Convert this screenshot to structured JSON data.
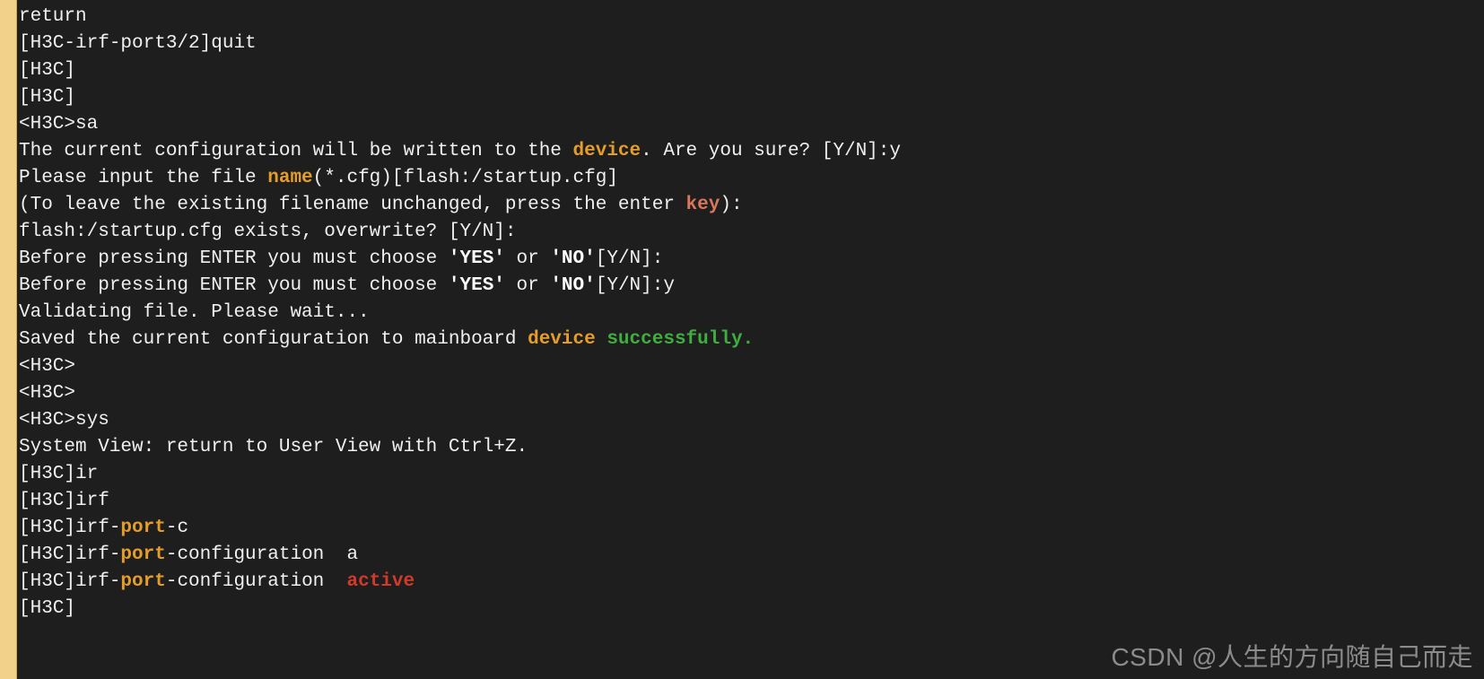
{
  "segments": [
    {
      "t": "return",
      "c": ""
    },
    {
      "t": "\n",
      "c": ""
    },
    {
      "t": "[H3C-irf-port3/2]quit",
      "c": ""
    },
    {
      "t": "\n",
      "c": ""
    },
    {
      "t": "[H3C]",
      "c": ""
    },
    {
      "t": "\n",
      "c": ""
    },
    {
      "t": "[H3C]",
      "c": ""
    },
    {
      "t": "\n",
      "c": ""
    },
    {
      "t": "<H3C>sa",
      "c": ""
    },
    {
      "t": "\n",
      "c": ""
    },
    {
      "t": "The current configuration will be written to the ",
      "c": ""
    },
    {
      "t": "device",
      "c": "hl-orange"
    },
    {
      "t": ". Are you sure? [Y/N]:y",
      "c": ""
    },
    {
      "t": "\n",
      "c": ""
    },
    {
      "t": "Please input the file ",
      "c": ""
    },
    {
      "t": "name",
      "c": "hl-orange"
    },
    {
      "t": "(*.cfg)[flash:/startup.cfg]",
      "c": ""
    },
    {
      "t": "\n",
      "c": ""
    },
    {
      "t": "(To leave the existing filename unchanged, press the enter ",
      "c": ""
    },
    {
      "t": "key",
      "c": "hl-salmon"
    },
    {
      "t": "):",
      "c": ""
    },
    {
      "t": "\n",
      "c": ""
    },
    {
      "t": "flash:/startup.cfg exists, overwrite? [Y/N]:",
      "c": ""
    },
    {
      "t": "\n",
      "c": ""
    },
    {
      "t": "Before pressing ENTER you must choose ",
      "c": ""
    },
    {
      "t": "'YES'",
      "c": "hl-bold"
    },
    {
      "t": " or ",
      "c": ""
    },
    {
      "t": "'NO'",
      "c": "hl-bold"
    },
    {
      "t": "[Y/N]:",
      "c": ""
    },
    {
      "t": "\n",
      "c": ""
    },
    {
      "t": "Before pressing ENTER you must choose ",
      "c": ""
    },
    {
      "t": "'YES'",
      "c": "hl-bold"
    },
    {
      "t": " or ",
      "c": ""
    },
    {
      "t": "'NO'",
      "c": "hl-bold"
    },
    {
      "t": "[Y/N]:y",
      "c": ""
    },
    {
      "t": "\n",
      "c": ""
    },
    {
      "t": "Validating file. Please wait...",
      "c": ""
    },
    {
      "t": "\n",
      "c": ""
    },
    {
      "t": "Saved the current configuration to mainboard ",
      "c": ""
    },
    {
      "t": "device",
      "c": "hl-orange"
    },
    {
      "t": " ",
      "c": ""
    },
    {
      "t": "successfully.",
      "c": "hl-green"
    },
    {
      "t": "\n",
      "c": ""
    },
    {
      "t": "<H3C>",
      "c": ""
    },
    {
      "t": "\n",
      "c": ""
    },
    {
      "t": "<H3C>",
      "c": ""
    },
    {
      "t": "\n",
      "c": ""
    },
    {
      "t": "<H3C>sys",
      "c": ""
    },
    {
      "t": "\n",
      "c": ""
    },
    {
      "t": "System View: return to User View with Ctrl+Z.",
      "c": ""
    },
    {
      "t": "\n",
      "c": ""
    },
    {
      "t": "[H3C]ir",
      "c": ""
    },
    {
      "t": "\n",
      "c": ""
    },
    {
      "t": "[H3C]irf",
      "c": ""
    },
    {
      "t": "\n",
      "c": ""
    },
    {
      "t": "[H3C]irf-",
      "c": ""
    },
    {
      "t": "port",
      "c": "hl-orange"
    },
    {
      "t": "-c",
      "c": ""
    },
    {
      "t": "\n",
      "c": ""
    },
    {
      "t": "[H3C]irf-",
      "c": ""
    },
    {
      "t": "port",
      "c": "hl-orange"
    },
    {
      "t": "-configuration  a",
      "c": ""
    },
    {
      "t": "\n",
      "c": ""
    },
    {
      "t": "[H3C]irf-",
      "c": ""
    },
    {
      "t": "port",
      "c": "hl-orange"
    },
    {
      "t": "-configuration  ",
      "c": ""
    },
    {
      "t": "active",
      "c": "hl-red"
    },
    {
      "t": "\n",
      "c": ""
    },
    {
      "t": "[H3C]",
      "c": ""
    }
  ],
  "watermark": "CSDN @人生的方向随自己而走"
}
